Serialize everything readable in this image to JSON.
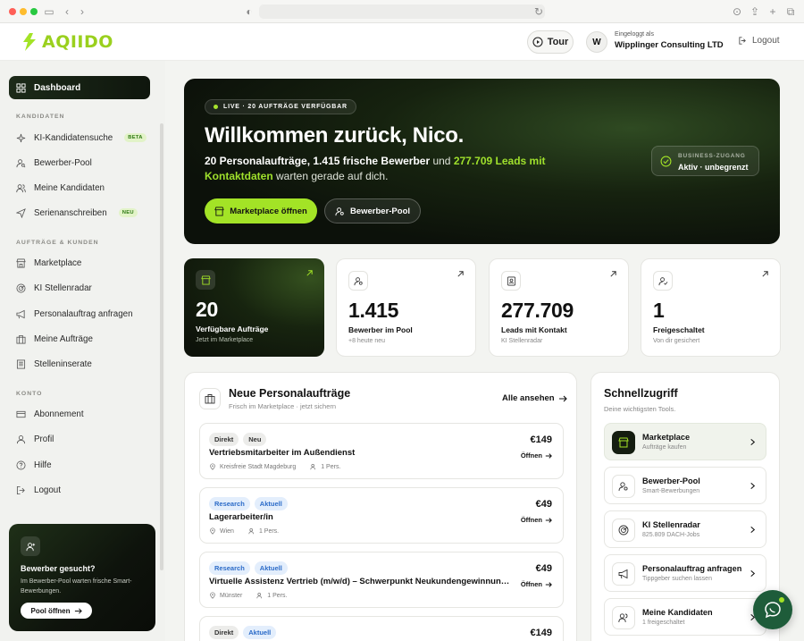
{
  "header": {
    "logo_text": "AQIIDO",
    "tour_label": "Tour",
    "avatar_initial": "W",
    "logged_in_label": "Eingeloggt als",
    "company": "Wipplinger Consulting LTD",
    "logout_label": "Logout"
  },
  "sidebar": {
    "active_item": "Dashboard",
    "sections": [
      {
        "label": "KANDIDATEN",
        "items": [
          {
            "label": "KI-Kandidatensuche",
            "badge": "BETA",
            "icon": "sparkle-icon"
          },
          {
            "label": "Bewerber-Pool",
            "badge": "",
            "icon": "user-search-icon"
          },
          {
            "label": "Meine Kandidaten",
            "badge": "",
            "icon": "users-icon"
          },
          {
            "label": "Serienanschreiben",
            "badge": "NEU",
            "icon": "send-icon"
          }
        ]
      },
      {
        "label": "AUFTRÄGE & KUNDEN",
        "items": [
          {
            "label": "Marketplace",
            "badge": "",
            "icon": "store-icon"
          },
          {
            "label": "KI Stellenradar",
            "badge": "",
            "icon": "radar-icon"
          },
          {
            "label": "Personalauftrag anfragen",
            "badge": "",
            "icon": "megaphone-icon"
          },
          {
            "label": "Meine Aufträge",
            "badge": "",
            "icon": "briefcase-icon"
          },
          {
            "label": "Stelleninserate",
            "badge": "",
            "icon": "newspaper-icon"
          }
        ]
      },
      {
        "label": "KONTO",
        "items": [
          {
            "label": "Abonnement",
            "badge": "",
            "icon": "credit-card-icon"
          },
          {
            "label": "Profil",
            "badge": "",
            "icon": "user-icon"
          },
          {
            "label": "Hilfe",
            "badge": "",
            "icon": "help-icon"
          },
          {
            "label": "Logout",
            "badge": "",
            "icon": "logout-icon"
          }
        ]
      }
    ],
    "promo": {
      "title": "Bewerber gesucht?",
      "text": "Im Bewerber-Pool warten frische Smart-Bewerbungen.",
      "button": "Pool öffnen"
    }
  },
  "hero": {
    "live_label": "LIVE · 20 AUFTRÄGE VERFÜGBAR",
    "title": "Willkommen zurück, Nico.",
    "sub_part1": "20 Personalaufträge, 1.415 frische Bewerber",
    "sub_part2": " und ",
    "sub_highlight": "277.709 Leads mit Kontaktdaten",
    "sub_part3": " warten gerade auf dich.",
    "btn_primary": "Marketplace öffnen",
    "btn_secondary": "Bewerber-Pool",
    "access_label": "BUSINESS-ZUGANG",
    "access_value": "Aktiv · unbegrenzt"
  },
  "stats": [
    {
      "value": "20",
      "label": "Verfügbare Aufträge",
      "sub": "Jetzt im Marketplace",
      "icon": "store-icon"
    },
    {
      "value": "1.415",
      "label": "Bewerber im Pool",
      "sub": "+8 heute neu",
      "icon": "user-search-icon"
    },
    {
      "value": "277.709",
      "label": "Leads mit Kontakt",
      "sub": "KI Stellenradar",
      "icon": "contact-icon"
    },
    {
      "value": "1",
      "label": "Freigeschaltet",
      "sub": "Von dir gesichert",
      "icon": "user-check-icon"
    }
  ],
  "jobs": {
    "title": "Neue Personalaufträge",
    "subtitle": "Frisch im Marketplace · jetzt sichern",
    "see_all": "Alle ansehen",
    "open_label": "Öffnen",
    "items": [
      {
        "tags": [
          "Direkt",
          "Neu"
        ],
        "tag_style": "grey",
        "title": "Vertriebsmitarbeiter im Außendienst",
        "location": "Kreisfreie Stadt Magdeburg",
        "persons": "1 Pers.",
        "price": "€149"
      },
      {
        "tags": [
          "Research",
          "Aktuell"
        ],
        "tag_style": "blue",
        "title": "Lagerarbeiter/in",
        "location": "Wien",
        "persons": "1 Pers.",
        "price": "€49"
      },
      {
        "tags": [
          "Research",
          "Aktuell"
        ],
        "tag_style": "blue",
        "title": "Virtuelle Assistenz Vertrieb (m/w/d) – Schwerpunkt Neukundengewinnung I ...",
        "location": "Münster",
        "persons": "1 Pers.",
        "price": "€49"
      },
      {
        "tags": [
          "Direkt",
          "Aktuell"
        ],
        "tag_style": "mixed",
        "title": "",
        "location": "",
        "persons": "",
        "price": "€149"
      }
    ]
  },
  "quick": {
    "title": "Schnellzugriff",
    "subtitle": "Deine wichtigsten Tools.",
    "items": [
      {
        "title": "Marketplace",
        "sub": "Aufträge kaufen",
        "icon": "store-icon"
      },
      {
        "title": "Bewerber-Pool",
        "sub": "Smart-Bewerbungen",
        "icon": "user-search-icon"
      },
      {
        "title": "KI Stellenradar",
        "sub": "825.809 DACH-Jobs",
        "icon": "radar-icon"
      },
      {
        "title": "Personalauftrag anfragen",
        "sub": "Tippgeber suchen lassen",
        "icon": "megaphone-icon"
      },
      {
        "title": "Meine Kandidaten",
        "sub": "1 freigeschaltet",
        "icon": "users-icon"
      }
    ]
  },
  "colors": {
    "accent": "#a3e326",
    "dark": "#0c110a",
    "tag_blue": "#2b6bc8"
  }
}
